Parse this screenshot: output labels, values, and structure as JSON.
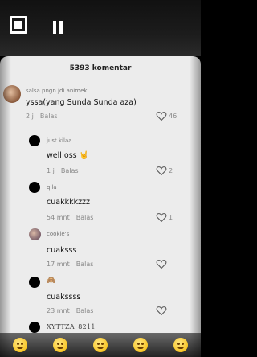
{
  "header": {
    "title": "5393 komentar"
  },
  "comments": [
    {
      "user": "salsa pngn jdi animek",
      "text": "yssa(yang Sunda Sunda aza)",
      "time": "2 j",
      "reply": "Balas",
      "likes": "46"
    },
    {
      "user": "just.kilaa",
      "text": "well oss 🤘",
      "time": "1 j",
      "reply": "Balas",
      "likes": "2"
    },
    {
      "user": "qila",
      "text": "cuakkkkzzz",
      "time": "54 mnt",
      "reply": "Balas",
      "likes": "1"
    },
    {
      "user": "cookie's",
      "text": "cuaksss",
      "time": "17 mnt",
      "reply": "Balas",
      "likes": ""
    },
    {
      "user": "🙈",
      "text": "cuakssss",
      "time": "23 mnt",
      "reply": "Balas",
      "likes": ""
    },
    {
      "user": "XYTTZA_8211"
    }
  ],
  "colors": {
    "sheet": "#ececec",
    "background": "#000000",
    "text": "#111111",
    "muted": "#888888"
  }
}
